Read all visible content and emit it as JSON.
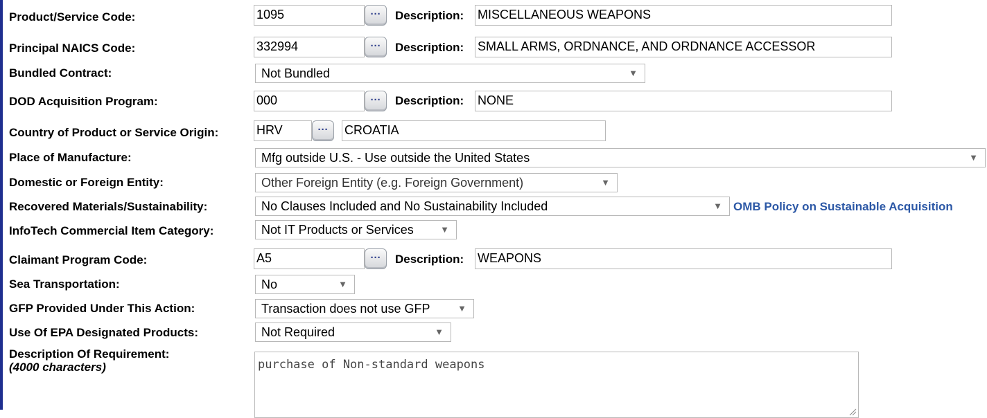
{
  "fields": {
    "psc": {
      "label": "Product/Service Code:",
      "value": "1095",
      "desc_label": "Description:",
      "desc_value": "MISCELLANEOUS WEAPONS"
    },
    "naics": {
      "label": "Principal NAICS Code:",
      "value": "332994",
      "desc_label": "Description:",
      "desc_value": "SMALL ARMS, ORDNANCE, AND ORDNANCE ACCESSOR"
    },
    "bundled": {
      "label": "Bundled Contract:",
      "selected": "Not Bundled"
    },
    "dod_program": {
      "label": "DOD Acquisition Program:",
      "value": "000",
      "desc_label": "Description:",
      "desc_value": "NONE"
    },
    "country": {
      "label": "Country of Product or Service Origin:",
      "value": "HRV",
      "desc_value": "CROATIA"
    },
    "place_mfg": {
      "label": "Place of Manufacture:",
      "selected": "Mfg outside U.S. - Use outside the United States"
    },
    "entity": {
      "label": "Domestic or Foreign Entity:",
      "selected": "Other Foreign Entity (e.g. Foreign Government)"
    },
    "recovered": {
      "label": "Recovered Materials/Sustainability:",
      "selected": "No Clauses Included and No Sustainability Included",
      "link": "OMB Policy on Sustainable Acquisition"
    },
    "infotech": {
      "label": "InfoTech Commercial Item Category:",
      "selected": "Not IT Products or Services"
    },
    "claimant": {
      "label": "Claimant Program Code:",
      "value": "A5",
      "desc_label": "Description:",
      "desc_value": "WEAPONS"
    },
    "sea": {
      "label": "Sea Transportation:",
      "selected": "No"
    },
    "gfp": {
      "label": "GFP Provided Under This Action:",
      "selected": "Transaction does not use GFP"
    },
    "epa": {
      "label": "Use Of EPA Designated Products:",
      "selected": "Not Required"
    },
    "requirement": {
      "label": "Description Of Requirement:",
      "sublabel": "(4000 characters)",
      "value": "purchase of Non-standard weapons"
    }
  },
  "lookup_button_glyph": "···",
  "dropdown_arrow": "▼",
  "colors": {
    "link": "#2c58a6",
    "left_border": "#1f2f8f",
    "input_border": "#b8b8b8"
  },
  "icons": {
    "lookup": "ellipsis-lookup-icon",
    "dropdown": "chevron-down-icon",
    "resize": "resize-grip-icon"
  }
}
